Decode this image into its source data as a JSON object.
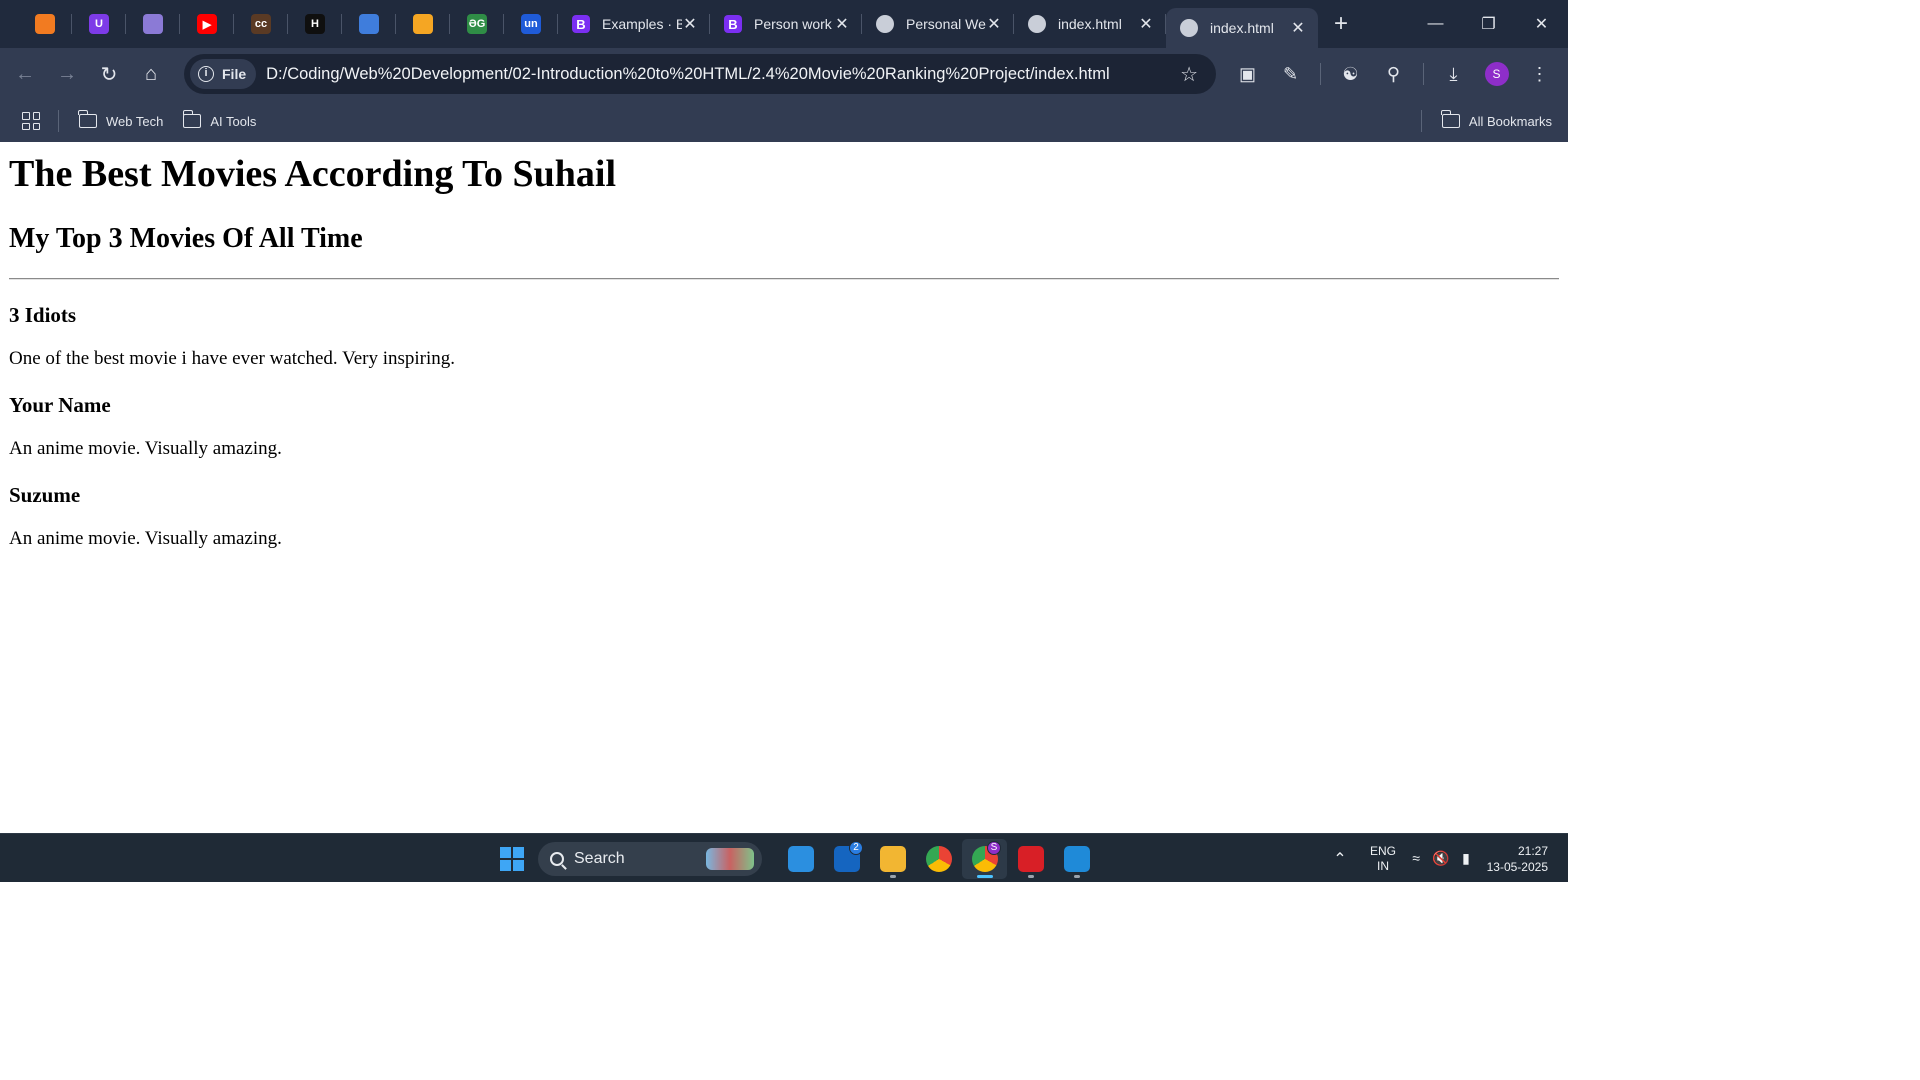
{
  "browser": {
    "pinned_tabs": [
      {
        "icon": "swiggy-icon",
        "label": "",
        "color": "#f27b21"
      },
      {
        "icon": "u-icon",
        "label": "U",
        "color": "#7d3be8"
      },
      {
        "icon": "avatar-app-icon",
        "label": "",
        "color": "#8b7ad6"
      },
      {
        "icon": "youtube-icon",
        "label": "▶",
        "color": "#ff0000"
      },
      {
        "icon": "cc-icon",
        "label": "cc",
        "color": "#5a3a24"
      },
      {
        "icon": "hackerrank-icon",
        "label": "H",
        "color": "#0f0f0f"
      },
      {
        "icon": "bar-chart-icon",
        "label": "",
        "color": "#3f7ddc"
      },
      {
        "icon": "codeforces-icon",
        "label": "",
        "color": "#f5a623"
      },
      {
        "icon": "geeksforgeeks-icon",
        "label": "ƏG",
        "color": "#2f8d46"
      },
      {
        "icon": "unstop-icon",
        "label": "un",
        "color": "#1f5bd8"
      }
    ],
    "tabs": [
      {
        "title": "Examples · B",
        "favicon": "bootstrap-icon",
        "fav_label": "B",
        "fav_color": "#7b2ff2",
        "active": false
      },
      {
        "title": "Person work",
        "favicon": "bootstrap-icon",
        "fav_label": "B",
        "fav_color": "#7b2ff2",
        "active": false
      },
      {
        "title": "Personal We",
        "favicon": "globe-icon",
        "fav_label": "",
        "fav_color": "",
        "active": false
      },
      {
        "title": "index.html",
        "favicon": "globe-icon",
        "fav_label": "",
        "fav_color": "",
        "active": false
      },
      {
        "title": "index.html",
        "favicon": "globe-icon",
        "fav_label": "",
        "fav_color": "",
        "active": true
      }
    ],
    "new_tab_label": "+",
    "address": {
      "chip_label": "File",
      "url": "D:/Coding/Web%20Development/02-Introduction%20to%20HTML/2.4%20Movie%20Ranking%20Project/index.html"
    },
    "profile_initial": "S",
    "bookmarks": [
      {
        "label": "Web Tech"
      },
      {
        "label": "AI Tools"
      }
    ],
    "all_bookmarks_label": "All Bookmarks"
  },
  "page": {
    "title": "The Best Movies According To Suhail",
    "subtitle": "My Top 3 Movies Of All Time",
    "movies": [
      {
        "name": "3 Idiots",
        "description": "One of the best movie i have ever watched. Very inspiring."
      },
      {
        "name": "Your Name",
        "description": "An anime movie. Visually amazing."
      },
      {
        "name": "Suzume",
        "description": "An anime movie. Visually amazing."
      }
    ]
  },
  "taskbar": {
    "search_label": "Search",
    "apps": [
      {
        "name": "store-icon",
        "color": "#2b8fe0",
        "label": "",
        "badge": "",
        "active": false
      },
      {
        "name": "outlook-icon",
        "color": "#1565c0",
        "label": "",
        "badge": "2",
        "active": false
      },
      {
        "name": "file-explorer-icon",
        "color": "#f2b632",
        "label": "",
        "badge": "",
        "active": false
      },
      {
        "name": "chrome-icon",
        "color": "#ea4335",
        "label": "",
        "badge": "",
        "active": false
      },
      {
        "name": "chrome-profile-icon",
        "color": "#ea4335",
        "label": "",
        "badge": "S",
        "active": true
      },
      {
        "name": "acrobat-icon",
        "color": "#d81f26",
        "label": "",
        "badge": "",
        "active": false
      },
      {
        "name": "vscode-icon",
        "color": "#1f8ad8",
        "label": "",
        "badge": "",
        "active": false
      }
    ],
    "language": {
      "line1": "ENG",
      "line2": "IN"
    },
    "time": "21:27",
    "date": "13-05-2025"
  }
}
